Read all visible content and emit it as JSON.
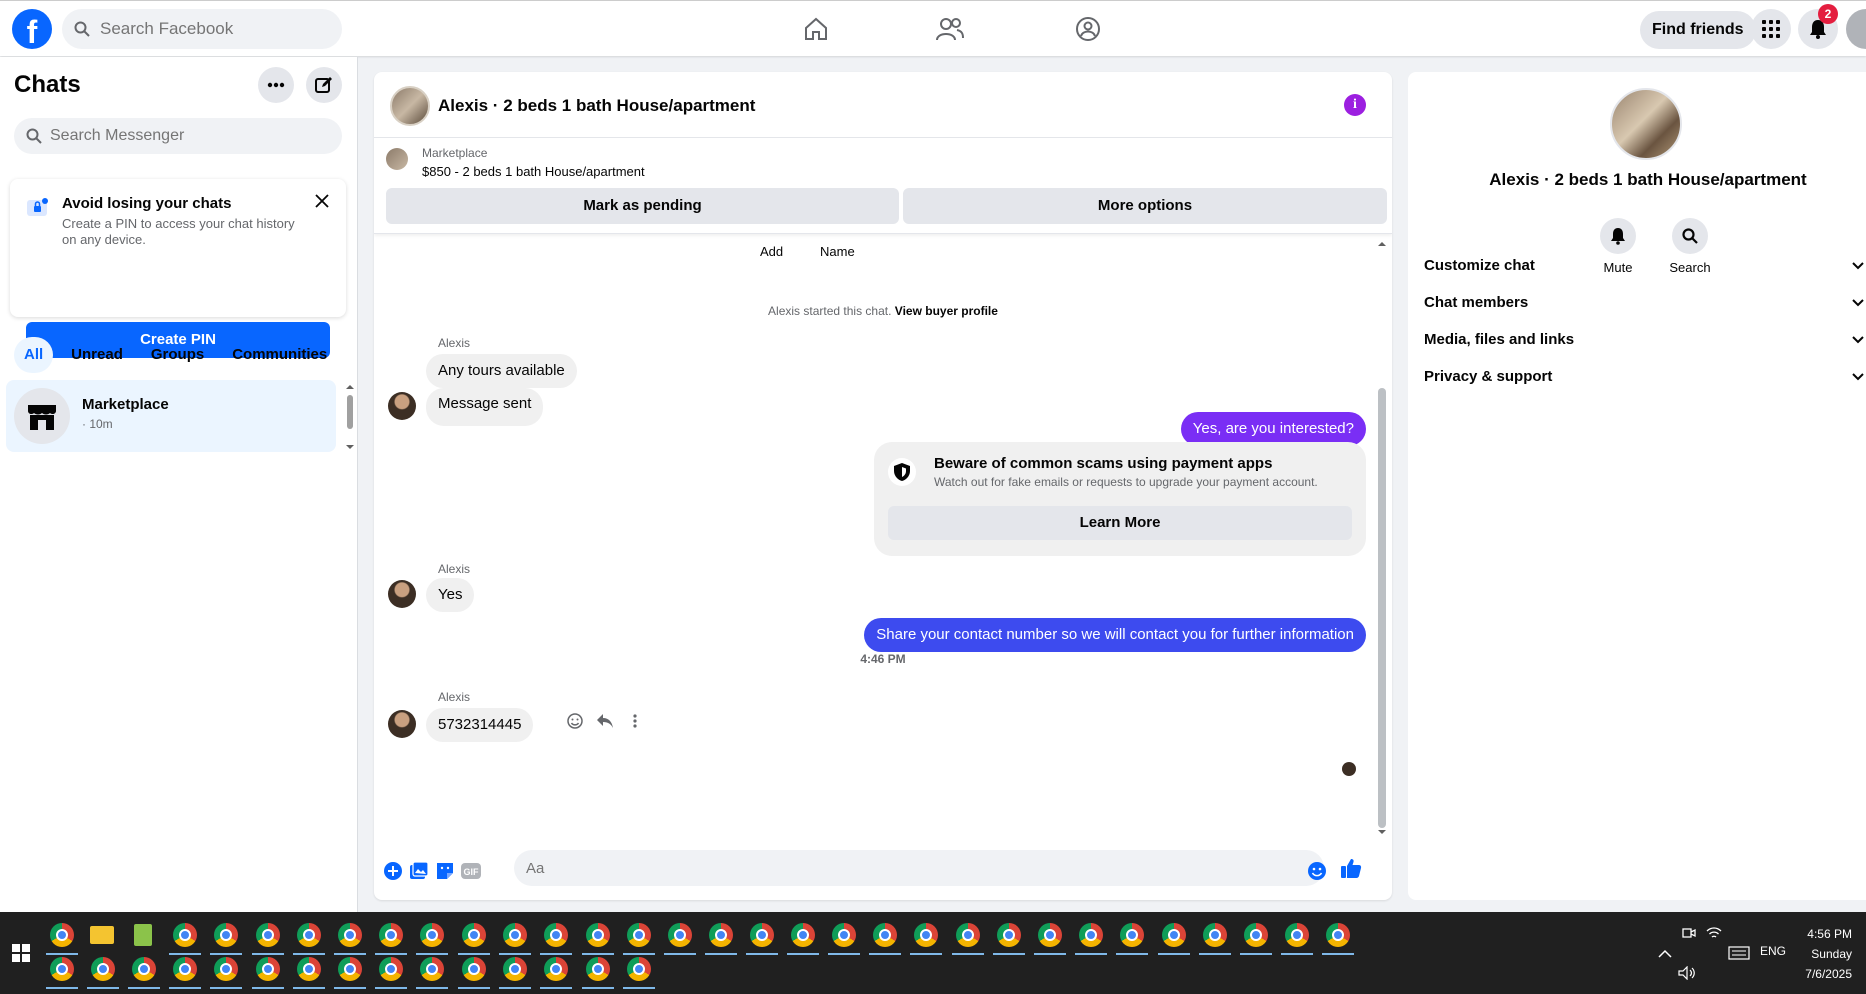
{
  "topnav": {
    "logo": "f",
    "search_placeholder": "Search Facebook",
    "find_friends": "Find friends",
    "notification_count": "2"
  },
  "sidebar": {
    "title": "Chats",
    "search_placeholder": "Search Messenger",
    "pin_card": {
      "title": "Avoid losing your chats",
      "description": "Create a PIN to access your chat history on any device.",
      "button": "Create PIN"
    },
    "filters": [
      "All",
      "Unread",
      "Groups",
      "Communities"
    ],
    "chat": {
      "name": "Marketplace",
      "time": "· 10m"
    }
  },
  "conversation": {
    "title": "Alexis · 2 beds 1 bath House/apartment",
    "marketplace_label": "Marketplace",
    "listing": "$850 - 2 beds 1 bath House/apartment",
    "mark_pending": "Mark as pending",
    "more_options": "More options",
    "top_actions": [
      "Add",
      "Name"
    ],
    "system_note": "Alexis started this chat.",
    "view_buyer_profile": "View buyer profile",
    "sender_name": "Alexis",
    "messages": {
      "m1": "Any tours available",
      "m2": "Message sent",
      "m3": "Yes, are you interested?",
      "m4": "Yes",
      "m5": "Share your contact number so we will contact you for further information",
      "m6": "5732314445"
    },
    "scam_warning": {
      "title": "Beware of common scams using payment apps",
      "description": "Watch out for fake emails or requests to upgrade your payment account.",
      "button": "Learn More"
    },
    "timestamp": "4:46 PM",
    "composer_placeholder": "Aa"
  },
  "right_panel": {
    "title": "Alexis · 2 beds 1 bath House/apartment",
    "actions": [
      "Mute",
      "Search"
    ],
    "sections": [
      "Customize chat",
      "Chat members",
      "Media, files and links",
      "Privacy & support"
    ]
  },
  "taskbar": {
    "time": "4:56 PM",
    "day": "Sunday",
    "date": "7/6/2025",
    "lang": "ENG"
  },
  "colors": {
    "brand_blue": "#0866ff",
    "outgoing_purple": "#7a2ef5",
    "outgoing_blue": "#3d4bef",
    "info_purple": "#9c1fe0"
  }
}
